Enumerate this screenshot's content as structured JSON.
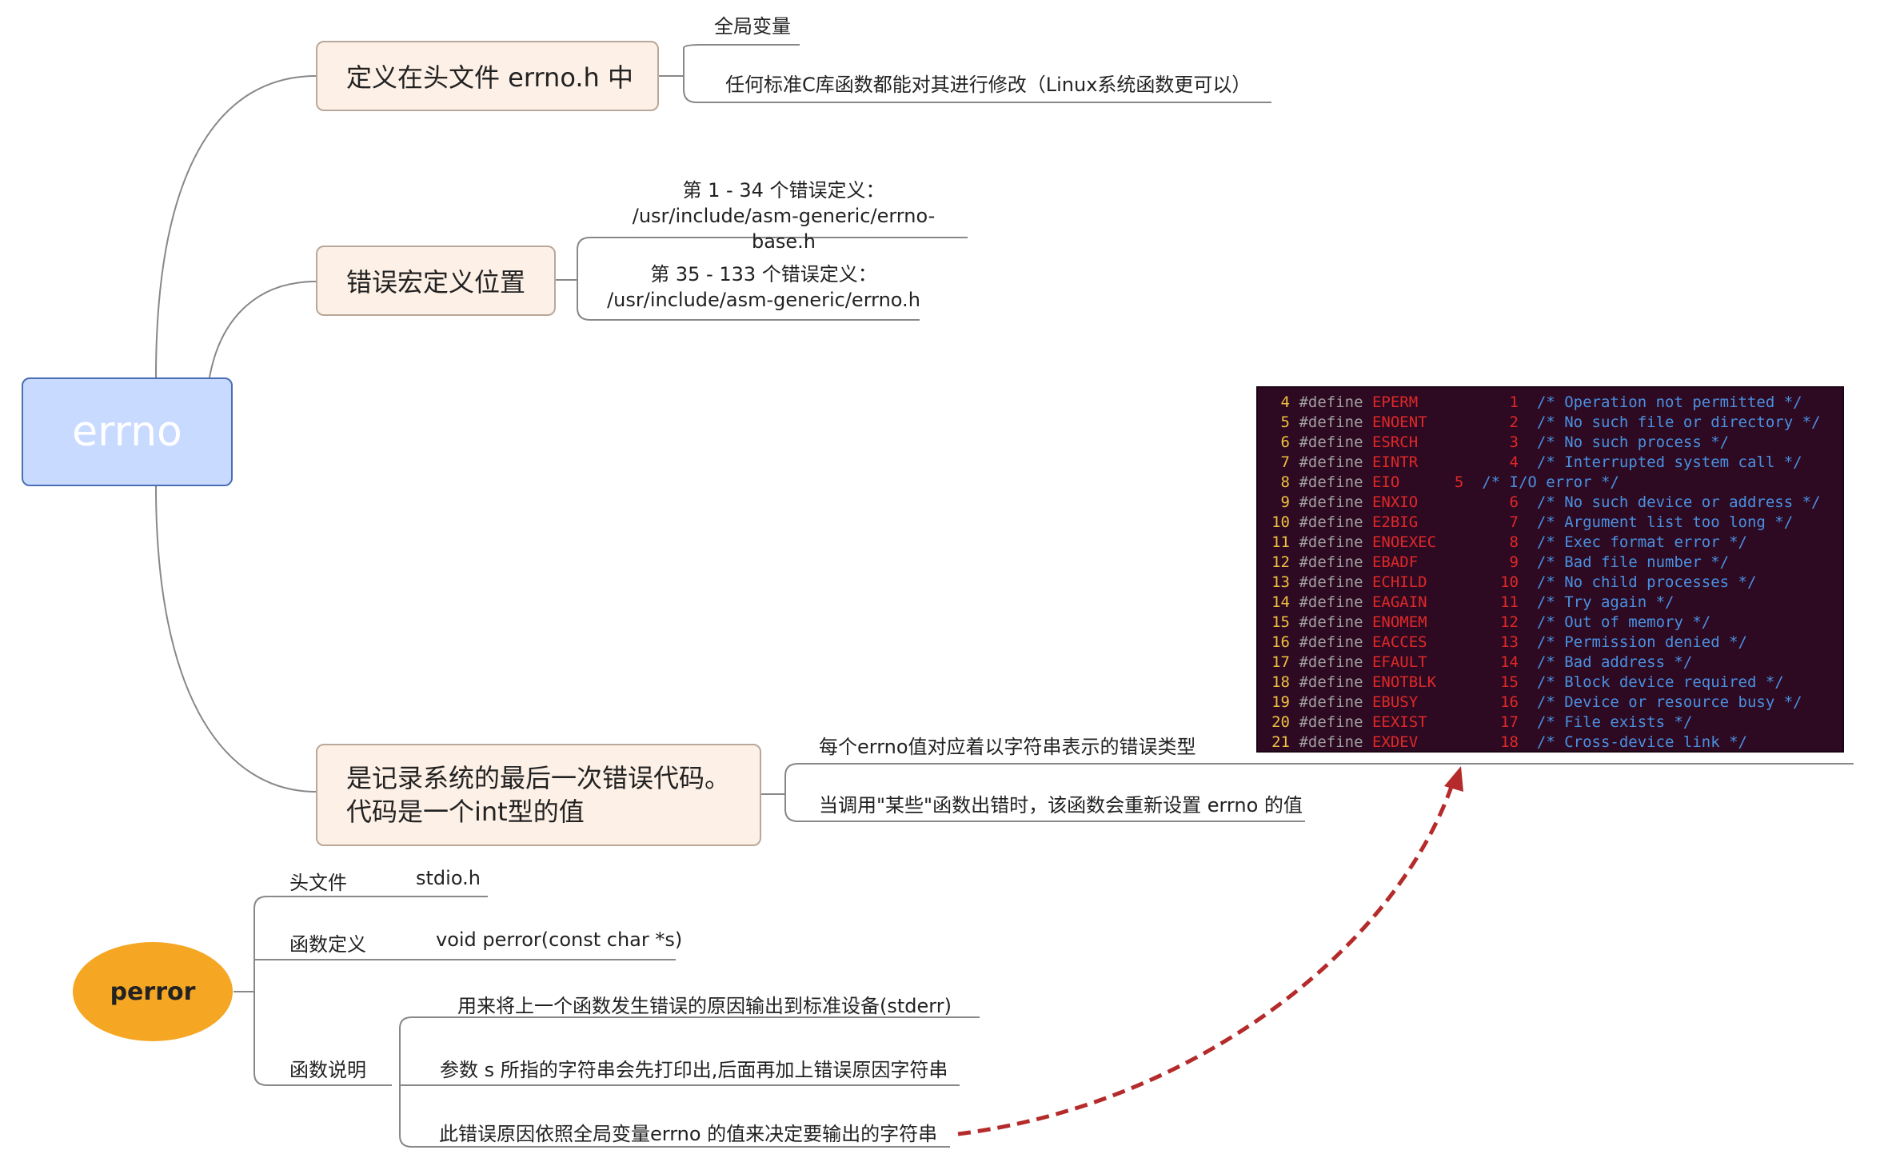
{
  "root": {
    "label": "errno"
  },
  "topics": [
    {
      "label": "定义在头文件 errno.h 中",
      "notes": [
        "全局变量",
        "任何标准C库函数都能对其进行修改（Linux系统函数更可以）"
      ]
    },
    {
      "label": "错误宏定义位置",
      "notes": [
        {
          "line1": "第 1 - 34 个错误定义：",
          "line2": "/usr/include/asm-generic/errno-base.h"
        },
        {
          "line1": "第 35 - 133 个错误定义：",
          "line2": "/usr/include/asm-generic/errno.h"
        }
      ]
    },
    {
      "line1": "是记录系统的最后一次错误代码。",
      "line2": "代码是一个int型的值",
      "notes": [
        "每个errno值对应着以字符串表示的错误类型",
        "当调用\"某些\"函数出错时，该函数会重新设置 errno 的值"
      ]
    }
  ],
  "perror": {
    "label": "perror",
    "header_label": "头文件",
    "header_value": "stdio.h",
    "def_label": "函数定义",
    "def_value": "void perror(const char *s)",
    "desc_label": "函数说明",
    "desc_items": [
      "用来将上一个函数发生错误的原因输出到标准设备(stderr)",
      "参数 s 所指的字符串会先打印出,后面再加上错误原因字符串",
      "此错误原因依照全局变量errno 的值来决定要输出的字符串"
    ]
  },
  "code_lines": [
    {
      "n": "4",
      "kw": "#define",
      "macro": "EPERM",
      "val": "1",
      "comment": "/* Operation not permitted */"
    },
    {
      "n": "5",
      "kw": "#define",
      "macro": "ENOENT",
      "val": "2",
      "comment": "/* No such file or directory */"
    },
    {
      "n": "6",
      "kw": "#define",
      "macro": "ESRCH",
      "val": "3",
      "comment": "/* No such process */"
    },
    {
      "n": "7",
      "kw": "#define",
      "macro": "EINTR",
      "val": "4",
      "comment": "/* Interrupted system call */"
    },
    {
      "n": "8",
      "kw": "#define",
      "macro": "EIO",
      "val": "5",
      "comment": "/* I/O error */"
    },
    {
      "n": "9",
      "kw": "#define",
      "macro": "ENXIO",
      "val": "6",
      "comment": "/* No such device or address */"
    },
    {
      "n": "10",
      "kw": "#define",
      "macro": "E2BIG",
      "val": "7",
      "comment": "/* Argument list too long */"
    },
    {
      "n": "11",
      "kw": "#define",
      "macro": "ENOEXEC",
      "val": "8",
      "comment": "/* Exec format error */"
    },
    {
      "n": "12",
      "kw": "#define",
      "macro": "EBADF",
      "val": "9",
      "comment": "/* Bad file number */"
    },
    {
      "n": "13",
      "kw": "#define",
      "macro": "ECHILD",
      "val": "10",
      "comment": "/* No child processes */"
    },
    {
      "n": "14",
      "kw": "#define",
      "macro": "EAGAIN",
      "val": "11",
      "comment": "/* Try again */"
    },
    {
      "n": "15",
      "kw": "#define",
      "macro": "ENOMEM",
      "val": "12",
      "comment": "/* Out of memory */"
    },
    {
      "n": "16",
      "kw": "#define",
      "macro": "EACCES",
      "val": "13",
      "comment": "/* Permission denied */"
    },
    {
      "n": "17",
      "kw": "#define",
      "macro": "EFAULT",
      "val": "14",
      "comment": "/* Bad address */"
    },
    {
      "n": "18",
      "kw": "#define",
      "macro": "ENOTBLK",
      "val": "15",
      "comment": "/* Block device required */"
    },
    {
      "n": "19",
      "kw": "#define",
      "macro": "EBUSY",
      "val": "16",
      "comment": "/* Device or resource busy */"
    },
    {
      "n": "20",
      "kw": "#define",
      "macro": "EEXIST",
      "val": "17",
      "comment": "/* File exists */"
    },
    {
      "n": "21",
      "kw": "#define",
      "macro": "EXDEV",
      "val": "18",
      "comment": "/* Cross-device link */"
    }
  ],
  "colors": {
    "root_fill": "#c8daff",
    "topic_fill": "#fdf0e6",
    "perror_fill": "#f5a623",
    "code_bg": "#2d0a22",
    "arrow": "#b52a2a"
  }
}
